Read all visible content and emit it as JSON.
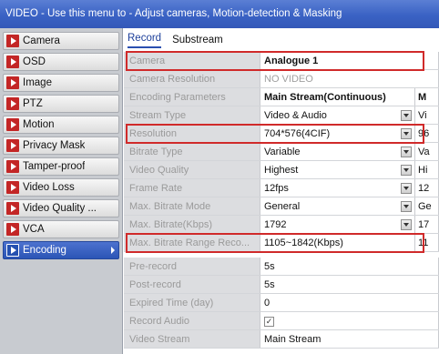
{
  "title": "VIDEO - Use this menu to - Adjust cameras, Motion-detection & Masking",
  "sidebar": {
    "items": [
      {
        "label": "Camera"
      },
      {
        "label": "OSD"
      },
      {
        "label": "Image"
      },
      {
        "label": "PTZ"
      },
      {
        "label": "Motion"
      },
      {
        "label": "Privacy Mask"
      },
      {
        "label": "Tamper-proof"
      },
      {
        "label": "Video Loss"
      },
      {
        "label": "Video Quality ..."
      },
      {
        "label": "VCA"
      },
      {
        "label": "Encoding"
      }
    ],
    "active": "Encoding"
  },
  "tabs": [
    "Record",
    "Substream"
  ],
  "form": {
    "camera": {
      "label": "Camera",
      "value": "Analogue 1"
    },
    "camera_resolution": {
      "label": "Camera Resolution",
      "value": "NO VIDEO"
    },
    "encoding_parameters": {
      "label": "Encoding Parameters",
      "value": "Main Stream(Continuous)",
      "extra": "M"
    },
    "stream_type": {
      "label": "Stream Type",
      "value": "Video & Audio",
      "extra": "Vi"
    },
    "resolution": {
      "label": "Resolution",
      "value": "704*576(4CIF)",
      "extra": "96"
    },
    "bitrate_type": {
      "label": "Bitrate Type",
      "value": "Variable",
      "extra": "Va"
    },
    "video_quality": {
      "label": "Video Quality",
      "value": "Highest",
      "extra": "Hi"
    },
    "frame_rate": {
      "label": "Frame Rate",
      "value": "12fps",
      "extra": "12"
    },
    "max_bitrate_mode": {
      "label": "Max. Bitrate Mode",
      "value": "General",
      "extra": "Ge"
    },
    "max_bitrate": {
      "label": "Max. Bitrate(Kbps)",
      "value": "1792",
      "extra": "17"
    },
    "max_bitrate_range": {
      "label": "Max. Bitrate Range Reco...",
      "value": "1105~1842(Kbps)",
      "extra": "11"
    },
    "pre_record": {
      "label": "Pre-record",
      "value": "5s"
    },
    "post_record": {
      "label": "Post-record",
      "value": "5s"
    },
    "expired_time": {
      "label": "Expired Time (day)",
      "value": "0"
    },
    "record_audio": {
      "label": "Record Audio",
      "checked": true,
      "check_glyph": "✓"
    },
    "video_stream": {
      "label": "Video Stream",
      "value": "Main Stream"
    }
  },
  "colors": {
    "accent": "#2b55b6",
    "highlight_box": "#d02a2a",
    "arrow_badge": "#c32626"
  }
}
